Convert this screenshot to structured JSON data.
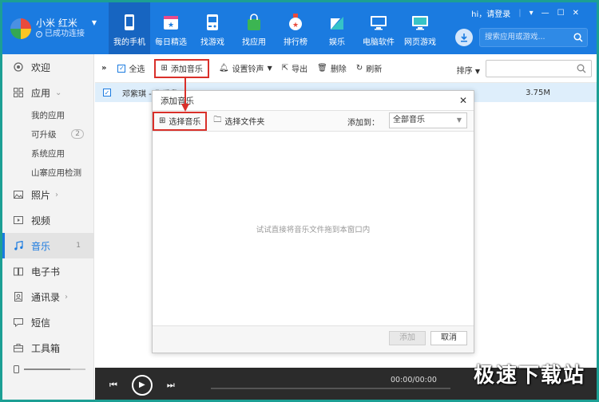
{
  "device": {
    "name": "小米 红米",
    "status": "已成功连接"
  },
  "nav": [
    {
      "id": "phone",
      "label": "我的手机",
      "active": true
    },
    {
      "id": "daily",
      "label": "每日精选"
    },
    {
      "id": "games",
      "label": "找游戏"
    },
    {
      "id": "apps",
      "label": "找应用"
    },
    {
      "id": "rank",
      "label": "排行榜"
    },
    {
      "id": "ent",
      "label": "娱乐"
    },
    {
      "id": "pc",
      "label": "电脑软件"
    },
    {
      "id": "web",
      "label": "网页游戏"
    }
  ],
  "window": {
    "login": "hi，请登录",
    "menu_icon": "menu-icon",
    "min_icon": "minimize-icon",
    "max_icon": "maximize-icon",
    "close_icon": "close-icon"
  },
  "top_search": {
    "placeholder": "搜索应用或游戏..."
  },
  "sidebar": {
    "welcome": "欢迎",
    "apps": "应用",
    "apps_sub": [
      {
        "label": "我的应用",
        "badge": ""
      },
      {
        "label": "可升级",
        "badge": "2"
      },
      {
        "label": "系统应用",
        "badge": ""
      },
      {
        "label": "山寨应用检测",
        "badge": ""
      }
    ],
    "photos": "照片",
    "video": "视频",
    "music": "音乐",
    "music_badge": "1",
    "ebook": "电子书",
    "contacts": "通讯录",
    "sms": "短信",
    "toolbox": "工具箱",
    "storage_fraction": 0.75
  },
  "toolbar": {
    "collapse": "»",
    "select_all": "全选",
    "add_music": "添加音乐",
    "ringtone": "设置铃声",
    "export": "导出",
    "delete": "删除",
    "refresh": "刷新",
    "sort": "排序"
  },
  "song": {
    "title": "邓紫琪 - 你爱我",
    "size": "3.75M"
  },
  "dialog": {
    "title": "添加音乐",
    "select_music": "选择音乐",
    "select_folder": "选择文件夹",
    "add_to_label": "添加到：",
    "add_to_value": "全部音乐",
    "hint": "试试直接将音乐文件拖到本窗口内",
    "add_button": "添加",
    "cancel_button": "取消"
  },
  "player": {
    "time": "00:00/00:00"
  },
  "watermark": "极速下载站",
  "colors": {
    "header": "#1b7be0",
    "nav_active": "#1765c1",
    "highlight": "#d9302a",
    "frame": "#1c9f94"
  }
}
